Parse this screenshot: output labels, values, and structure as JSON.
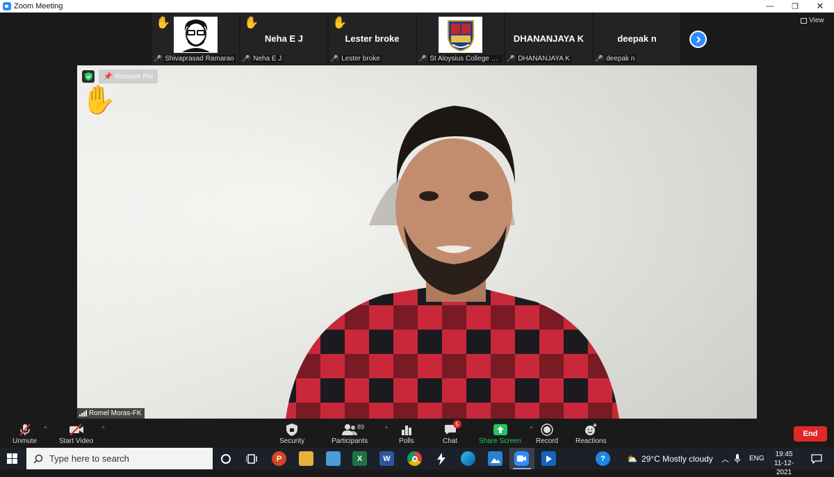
{
  "window": {
    "title": "Zoom Meeting",
    "minimize": "—",
    "restore": "❐",
    "close": "✕"
  },
  "strip": {
    "tiles": [
      {
        "name": "",
        "label": "Shivaprasad Ramarao",
        "has_image": "avatar"
      },
      {
        "name": "Neha E J",
        "label": "Neha E J"
      },
      {
        "name": "Lester broke",
        "label": "Lester broke"
      },
      {
        "name": "",
        "label": "St Aloysius College Ma...",
        "has_image": "crest"
      },
      {
        "name": "DHANANJAYA K",
        "label": "DHANANJAYA K"
      },
      {
        "name": "deepak n",
        "label": "deepak n"
      }
    ],
    "view_label": "View"
  },
  "main_video": {
    "remove_pin_label": "Remove Pin",
    "speaker_name": "Romel Moras-FK"
  },
  "controls": {
    "unmute": "Unmute",
    "start_video": "Start Video",
    "security": "Security",
    "participants": "Participants",
    "participants_count": "89",
    "polls": "Polls",
    "chat": "Chat",
    "chat_badge": "5",
    "share_screen": "Share Screen",
    "record": "Record",
    "reactions": "Reactions",
    "end": "End"
  },
  "taskbar": {
    "search_placeholder": "Type here to search",
    "weather": "29°C  Mostly cloudy",
    "language": "ENG",
    "time": "19:45",
    "date": "11-12-2021"
  },
  "colors": {
    "accent": "#2d8cff",
    "end": "#e02828",
    "share": "#22c55e",
    "raise_hand": "#f4c430"
  }
}
